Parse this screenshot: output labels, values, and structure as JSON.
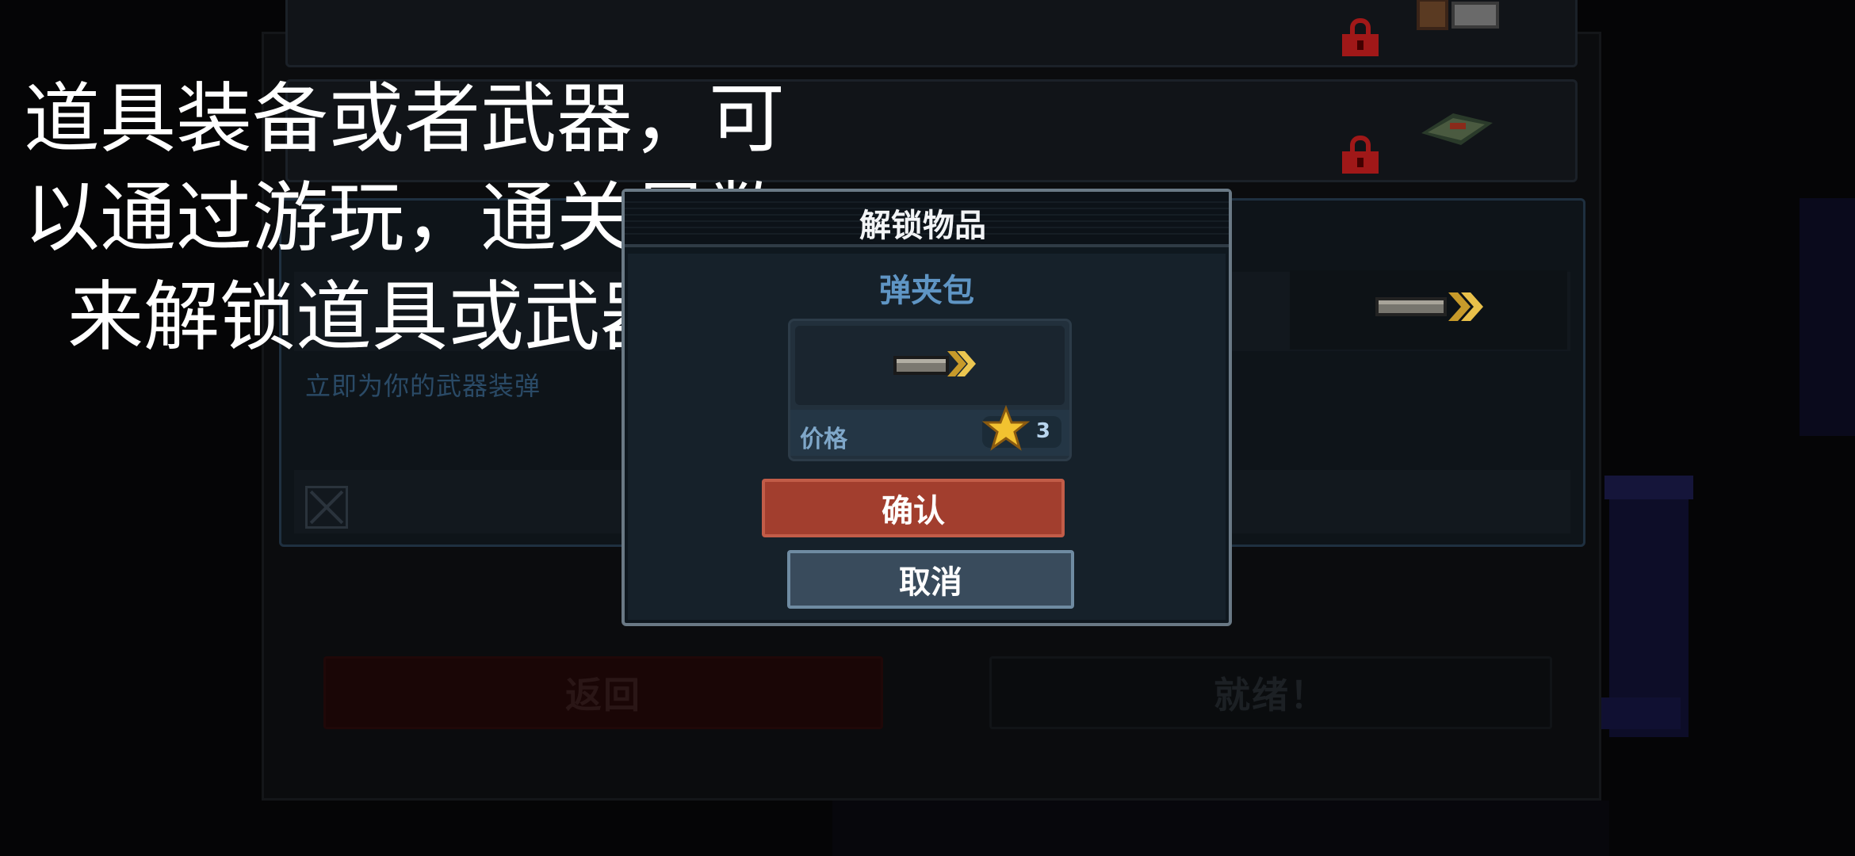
{
  "caption": {
    "line1": "道具装备或者武器，可",
    "line2": "以通过游玩，通关星数",
    "line3": "来解锁道具或武器等"
  },
  "background": {
    "description": "立即为你的武器装弹",
    "back_button": "返回",
    "ready_button": "就绪！"
  },
  "modal": {
    "title": "解锁物品",
    "item_name": "弹夹包",
    "price_label": "价格",
    "price_value": "3",
    "confirm_label": "确认",
    "cancel_label": "取消"
  },
  "colors": {
    "confirm": "#a23e2e",
    "cancel": "#394b5c",
    "item_name": "#5f95c4",
    "lock": "#a01818",
    "star": "#f2c230"
  },
  "icons": [
    "lock-icon",
    "star-icon",
    "ammo-clip-icon",
    "x-checkbox-icon"
  ]
}
